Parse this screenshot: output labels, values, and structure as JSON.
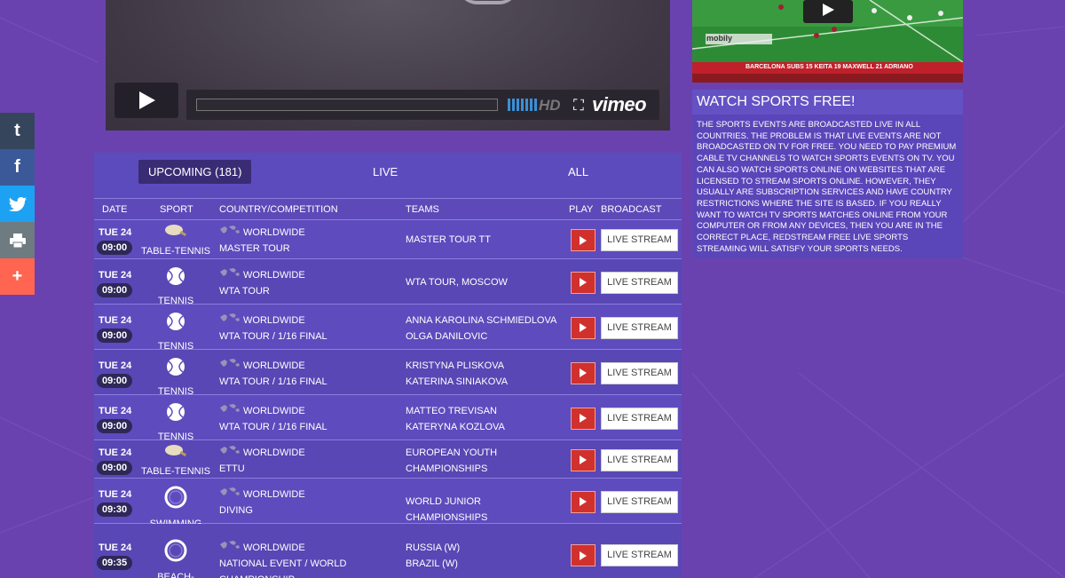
{
  "social": [
    "tumblr",
    "facebook",
    "twitter",
    "print",
    "more"
  ],
  "player": {
    "brand": "vimeo",
    "hd": "HD"
  },
  "tabs": {
    "upcoming": "UPCOMING (181)",
    "live": "LIVE",
    "all": "ALL"
  },
  "headers": {
    "date": "DATE",
    "sport": "SPORT",
    "competition": "COUNTRY/COMPETITION",
    "teams": "TEAMS",
    "play": "PLAY",
    "broadcast": "BROADCAST"
  },
  "rows": [
    {
      "date": "TUE 24",
      "time": "09:00",
      "sport": "TABLE-TENNIS",
      "icon": "table-tennis-icon",
      "country": "WORLDWIDE",
      "competition": "MASTER TOUR",
      "team1": "MASTER TOUR TT",
      "team2": "",
      "broadcast": "LIVE STREAM"
    },
    {
      "date": "TUE 24",
      "time": "09:00",
      "sport": "TENNIS",
      "icon": "tennis-icon",
      "country": "WORLDWIDE",
      "competition": "WTA TOUR",
      "team1": "WTA TOUR, MOSCOW",
      "team2": "",
      "broadcast": "LIVE STREAM"
    },
    {
      "date": "TUE 24",
      "time": "09:00",
      "sport": "TENNIS",
      "icon": "tennis-icon",
      "country": "WORLDWIDE",
      "competition": "WTA TOUR / 1/16 FINAL",
      "team1": "ANNA KAROLINA SCHMIEDLOVA",
      "team2": "OLGA DANILOVIC",
      "broadcast": "LIVE STREAM"
    },
    {
      "date": "TUE 24",
      "time": "09:00",
      "sport": "TENNIS",
      "icon": "tennis-icon",
      "country": "WORLDWIDE",
      "competition": "WTA TOUR / 1/16 FINAL",
      "team1": "KRISTYNA PLISKOVA",
      "team2": "KATERINA SINIAKOVA",
      "broadcast": "LIVE STREAM"
    },
    {
      "date": "TUE 24",
      "time": "09:00",
      "sport": "TENNIS",
      "icon": "tennis-icon",
      "country": "WORLDWIDE",
      "competition": "WTA TOUR / 1/16 FINAL",
      "team1": "MATTEO TREVISAN",
      "team2": "KATERYNA KOZLOVA",
      "broadcast": "LIVE STREAM"
    },
    {
      "date": "TUE 24",
      "time": "09:00",
      "sport": "TABLE-TENNIS",
      "icon": "table-tennis-icon",
      "country": "WORLDWIDE",
      "competition": "ETTU",
      "team1": "EUROPEAN YOUTH",
      "team2": "CHAMPIONSHIPS",
      "broadcast": "LIVE STREAM"
    },
    {
      "date": "TUE 24",
      "time": "09:30",
      "sport": "SWIMMING",
      "icon": "swimming-icon",
      "country": "WORLDWIDE",
      "competition": "DIVING",
      "team1": "WORLD JUNIOR CHAMPIONSHIPS",
      "team2": "",
      "broadcast": "LIVE STREAM"
    },
    {
      "date": "TUE 24",
      "time": "09:35",
      "sport": "BEACH-HANDBALL",
      "icon": "handball-icon",
      "country": "WORLDWIDE",
      "competition": "NATIONAL EVENT / WORLD CHAMPIONSHIP",
      "team1": "RUSSIA (W)",
      "team2": "BRAZIL (W)",
      "broadcast": "LIVE STREAM"
    }
  ],
  "thumbnail": {
    "caption": "BARCELONA SUBS 15 KEITA 19 MAXWELL 21 ADRIANO",
    "sponsor": "mobily"
  },
  "watch": {
    "title": "WATCH SPORTS FREE!",
    "text": "The sports events are broadcasted live in all countries. The problem is that live events are not broadcasted on TV for free. You need to pay premium cable TV channels to watch sports events on TV. You can also watch sports online on websites that are licensed to stream sports online. However, they usually are subscription services and have country restrictions where the site is based. If you really want to watch TV sports matches online from your computer or from any devices, then you are in the correct place, redstream free live sports streaming will satisfy your sports needs."
  }
}
